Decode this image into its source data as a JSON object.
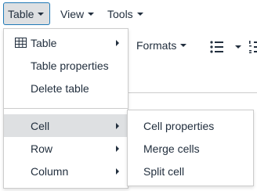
{
  "menubar": {
    "items": [
      {
        "label": "Table",
        "icon": "chevron-down-icon",
        "active": true
      },
      {
        "label": "View",
        "icon": "chevron-down-icon"
      },
      {
        "label": "Tools",
        "icon": "chevron-down-icon"
      }
    ]
  },
  "toolbar": {
    "formats_label": "Formats",
    "list_icon": "bullet-list-icon",
    "numbered_list_icon": "numbered-list-icon"
  },
  "table_menu": {
    "items": [
      {
        "label": "Table",
        "icon": "table-grid-icon",
        "has_submenu": true
      },
      {
        "label": "Table properties"
      },
      {
        "label": "Delete table"
      },
      {
        "label": "Cell",
        "has_submenu": true,
        "highlighted": true
      },
      {
        "label": "Row",
        "has_submenu": true
      },
      {
        "label": "Column",
        "has_submenu": true
      }
    ]
  },
  "cell_submenu": {
    "items": [
      {
        "label": "Cell properties"
      },
      {
        "label": "Merge cells"
      },
      {
        "label": "Split cell"
      }
    ]
  },
  "colors": {
    "text": "#222f3e",
    "highlight": "#dee0e2",
    "active_border": "#207ab7",
    "border": "#cccccc"
  }
}
